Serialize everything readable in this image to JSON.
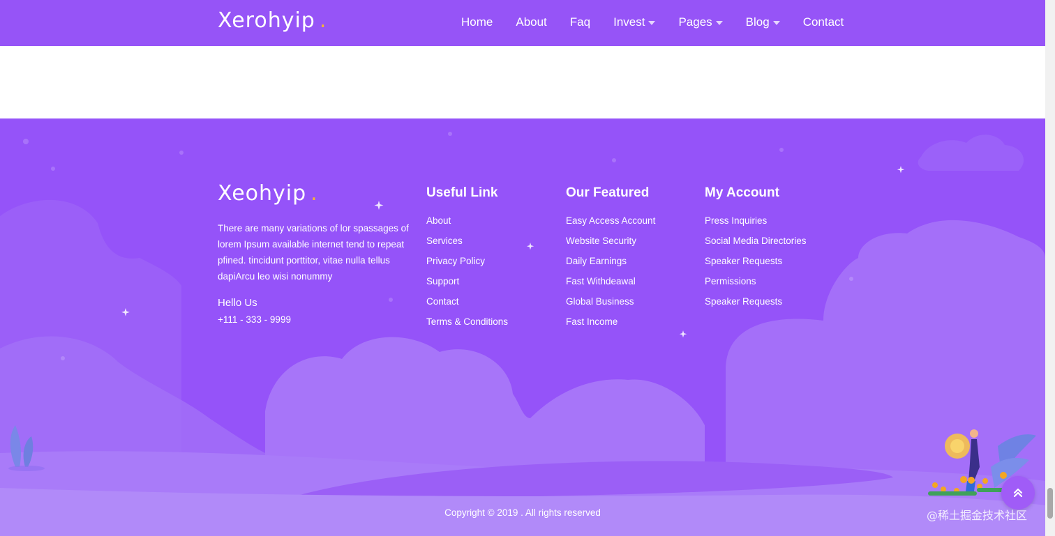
{
  "nav": {
    "brand": "Xerohyip",
    "brand_dot": ".",
    "items": [
      {
        "label": "Home",
        "dropdown": false
      },
      {
        "label": "About",
        "dropdown": false
      },
      {
        "label": "Faq",
        "dropdown": false
      },
      {
        "label": "Invest",
        "dropdown": true
      },
      {
        "label": "Pages",
        "dropdown": true
      },
      {
        "label": "Blog",
        "dropdown": true
      },
      {
        "label": "Contact",
        "dropdown": false
      }
    ]
  },
  "footer": {
    "logo": "Xeohyip",
    "logo_dot": ".",
    "about_text": "There are many variations of lor spassages of lorem Ipsum available internet tend to repeat pfined. tincidunt porttitor, vitae nulla tellus dapiArcu leo wisi nonummy",
    "hello_label": "Hello Us",
    "phone": "+111 - 333 - 9999",
    "columns": [
      {
        "title": "Useful Link",
        "links": [
          "About",
          "Services",
          "Privacy Policy",
          "Support",
          "Contact",
          "Terms & Conditions"
        ]
      },
      {
        "title": "Our Featured",
        "links": [
          "Easy Access Account",
          "Website Security",
          "Daily Earnings",
          "Fast Withdeawal",
          "Global Business",
          "Fast Income"
        ]
      },
      {
        "title": "My Account",
        "links": [
          "Press Inquiries",
          "Social Media Directories",
          "Speaker Requests",
          "Permissions",
          "Speaker Requests"
        ]
      }
    ],
    "copyright": "Copyright © 2019 . All rights reserved",
    "watermark": "@稀土掘金技术社区"
  },
  "colors": {
    "nav_bg": "#9654f7",
    "footer_bg": "#9553f9",
    "accent_dot": "#f5b534"
  },
  "icons": {
    "back_to_top": "double-chevron-up-icon",
    "dropdown": "caret-down-icon"
  }
}
